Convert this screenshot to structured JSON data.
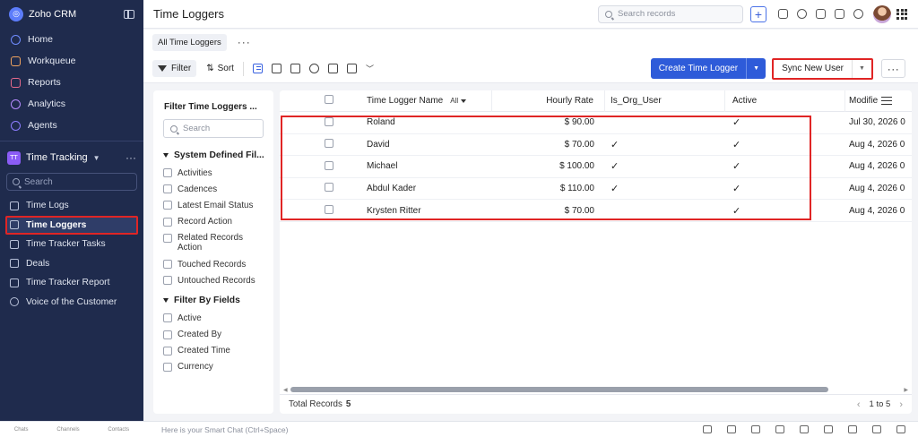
{
  "app": {
    "name": "Zoho CRM"
  },
  "sidebar": {
    "nav": [
      {
        "label": "Home"
      },
      {
        "label": "Workqueue"
      },
      {
        "label": "Reports"
      },
      {
        "label": "Analytics"
      },
      {
        "label": "Agents"
      }
    ],
    "module": {
      "badge": "TT",
      "label": "Time Tracking"
    },
    "search_placeholder": "Search",
    "items": [
      {
        "label": "Time Logs"
      },
      {
        "label": "Time Loggers"
      },
      {
        "label": "Time Tracker Tasks"
      },
      {
        "label": "Deals"
      },
      {
        "label": "Time Tracker Report"
      },
      {
        "label": "Voice of the Customer"
      }
    ]
  },
  "header": {
    "title": "Time Loggers",
    "search_placeholder": "Search records"
  },
  "views": {
    "active": "All Time Loggers",
    "more": "···"
  },
  "toolbar": {
    "filter": "Filter",
    "sort": "Sort",
    "create": "Create Time Logger",
    "sync": "Sync New User",
    "more": "···"
  },
  "filter_panel": {
    "title": "Filter Time Loggers ...",
    "search_placeholder": "Search",
    "system_title": "System Defined Fil...",
    "system_items": [
      "Activities",
      "Cadences",
      "Latest Email Status",
      "Record Action",
      "Related Records Action",
      "Touched Records",
      "Untouched Records"
    ],
    "fields_title": "Filter By Fields",
    "field_items": [
      "Active",
      "Created By",
      "Created Time",
      "Currency"
    ]
  },
  "table": {
    "columns": {
      "name": "Time Logger Name",
      "name_filter": "All",
      "rate": "Hourly Rate",
      "org": "Is_Org_User",
      "active": "Active",
      "modified": "Modifie"
    },
    "rows": [
      {
        "name": "Roland",
        "rate": "$ 90.00",
        "org": "",
        "active": "✓",
        "modified": "Jul 30, 2026 0"
      },
      {
        "name": "David",
        "rate": "$ 70.00",
        "org": "✓",
        "active": "✓",
        "modified": "Aug 4, 2026 0"
      },
      {
        "name": "Michael",
        "rate": "$ 100.00",
        "org": "✓",
        "active": "✓",
        "modified": "Aug 4, 2026 0"
      },
      {
        "name": "Abdul Kader",
        "rate": "$ 110.00",
        "org": "✓",
        "active": "✓",
        "modified": "Aug 4, 2026 0"
      },
      {
        "name": "Krysten Ritter",
        "rate": "$ 70.00",
        "org": "",
        "active": "✓",
        "modified": "Aug 4, 2026 0"
      }
    ],
    "footer": {
      "label": "Total Records",
      "count": "5",
      "range": "1 to 5"
    }
  },
  "bottom": {
    "left": [
      "Chats",
      "Channels",
      "Contacts"
    ],
    "smart_chat": "Here is your Smart Chat (Ctrl+Space)"
  },
  "colors": {
    "sidebar_bg": "#1f2b4d",
    "primary": "#2e5bd9",
    "highlight": "#e02525"
  }
}
